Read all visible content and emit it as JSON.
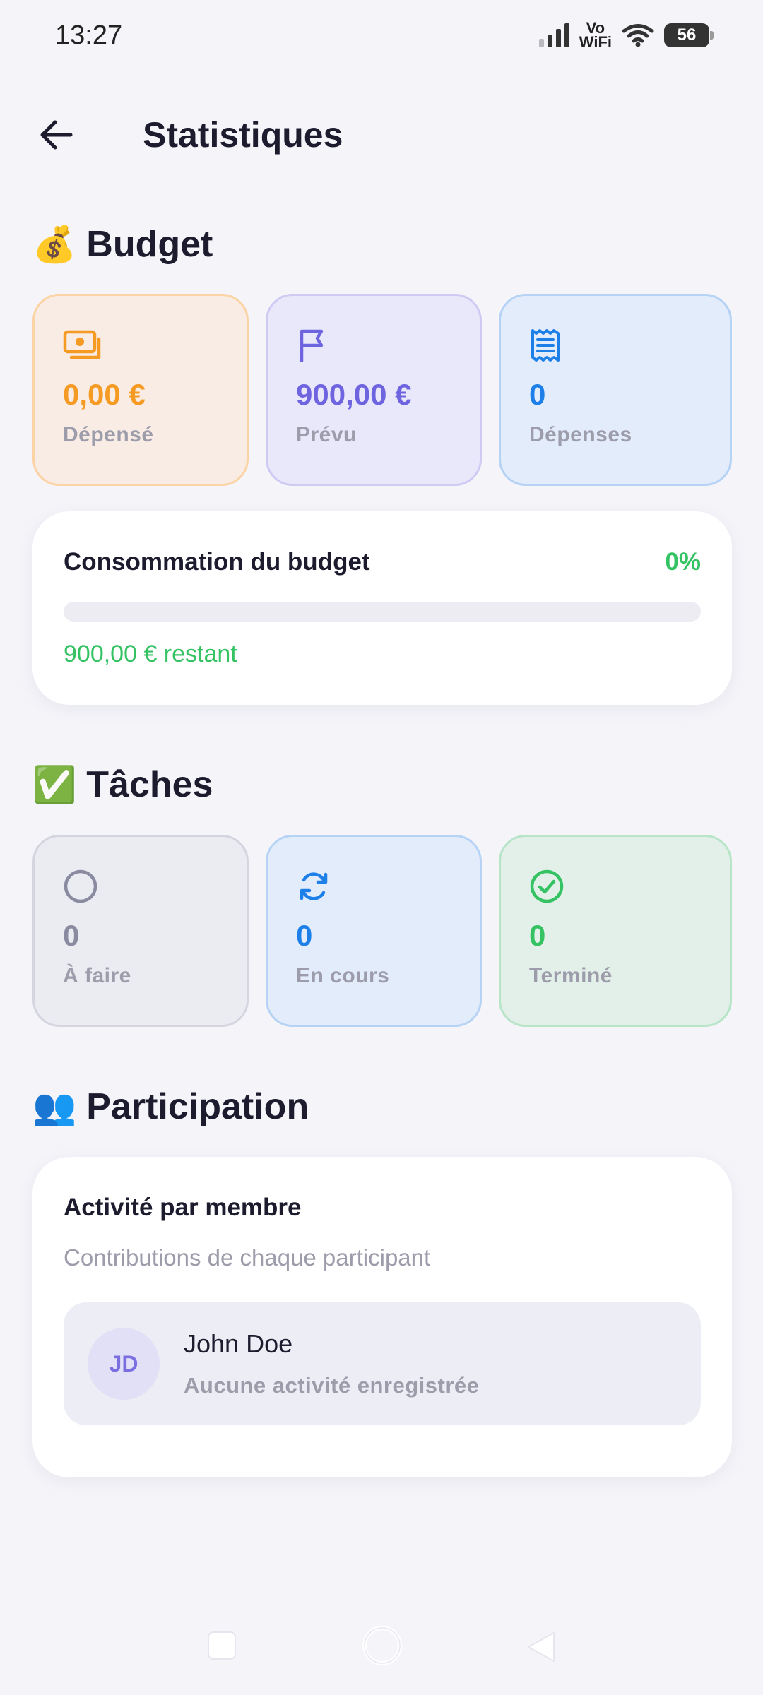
{
  "status_bar": {
    "time": "13:27",
    "network_label_line1": "Vo",
    "network_label_line2": "WiFi",
    "battery": "56"
  },
  "header": {
    "title": "Statistiques",
    "back_icon": "arrow-left-icon"
  },
  "budget": {
    "section_emoji": "💰",
    "section_title": "Budget",
    "stats": [
      {
        "icon": "money-icon",
        "value": "0,00 €",
        "label": "Dépensé",
        "accent": "#f59a23"
      },
      {
        "icon": "flag-icon",
        "value": "900,00 €",
        "label": "Prévu",
        "accent": "#6f64df"
      },
      {
        "icon": "receipt-icon",
        "value": "0",
        "label": "Dépenses",
        "accent": "#1d7fe8"
      }
    ],
    "consumption": {
      "label": "Consommation du budget",
      "percent": "0%",
      "fill_fraction": 0,
      "remaining": "900,00 € restant"
    }
  },
  "tasks": {
    "section_emoji": "✅",
    "section_title": "Tâches",
    "stats": [
      {
        "icon": "circle-icon",
        "value": "0",
        "label": "À faire",
        "accent": "#8a8aa0"
      },
      {
        "icon": "refresh-icon",
        "value": "0",
        "label": "En cours",
        "accent": "#1d7fe8"
      },
      {
        "icon": "check-circle-icon",
        "value": "0",
        "label": "Terminé",
        "accent": "#34c263"
      }
    ]
  },
  "participation": {
    "section_emoji": "👥",
    "section_title": "Participation",
    "card_title": "Activité par membre",
    "card_subtitle": "Contributions de chaque participant",
    "members": [
      {
        "initials": "JD",
        "name": "John Doe",
        "activity": "Aucune activité enregistrée"
      }
    ]
  },
  "nav_bar": {
    "icons": [
      "square-icon",
      "circle-home-icon",
      "triangle-back-icon"
    ]
  },
  "colors": {
    "background": "#f4f4f9",
    "success": "#34c263",
    "text_primary": "#1c1c2e",
    "text_muted": "#9c9cab"
  }
}
